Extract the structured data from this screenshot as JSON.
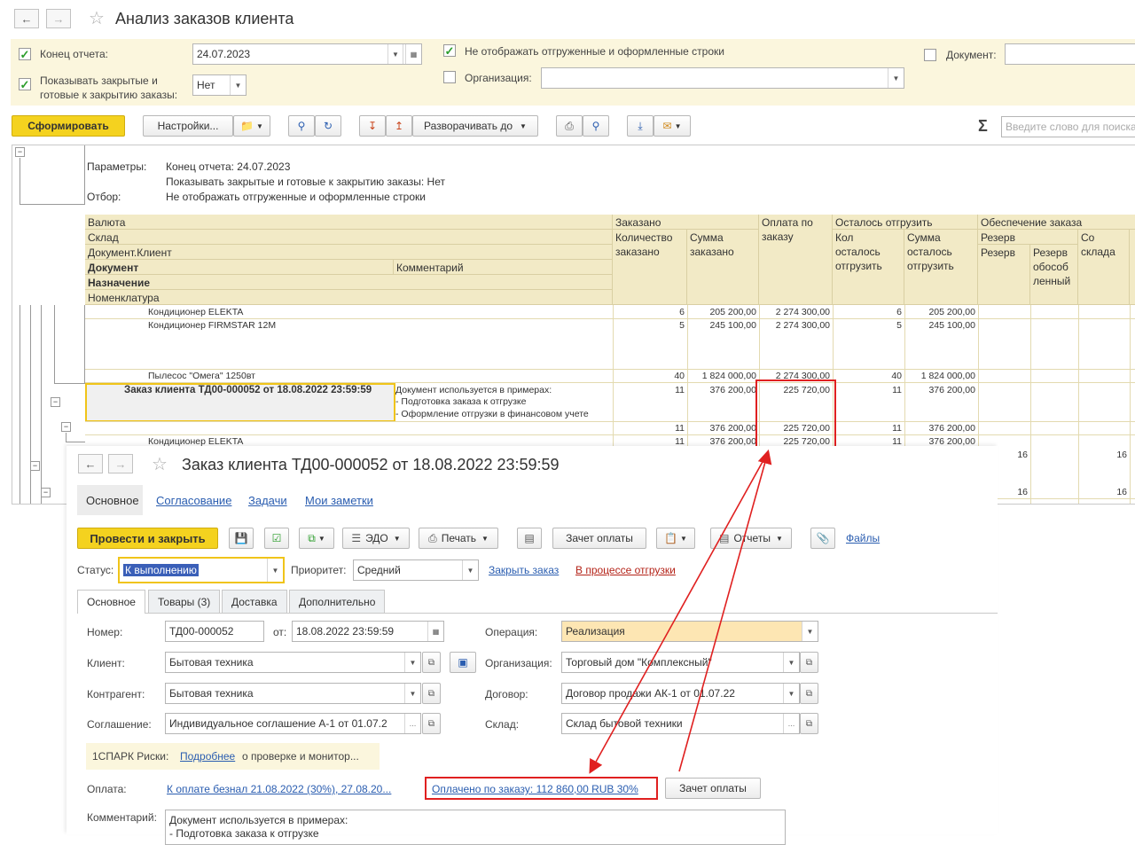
{
  "report": {
    "title": "Анализ заказов клиента",
    "end_label": "Конец отчета:",
    "end_date": "24.07.2023",
    "closed_label_1": "Показывать закрытые и",
    "closed_label_2": "готовые к закрытию заказы:",
    "closed_value": "Нет",
    "hide_label": "Не отображать отгруженные и оформленные строки",
    "org_label": "Организация:",
    "doc_label": "Документ:",
    "generate_btn": "Сформировать",
    "settings_btn": "Настройки...",
    "expand_btn": "Разворачивать до",
    "search_placeholder": "Введите слово для поиска",
    "sum_icon": "Σ",
    "params": {
      "params_label": "Параметры:",
      "p1": "Конец отчета: 24.07.2023",
      "p2": "Показывать закрытые и готовые к закрытию заказы: Нет",
      "filter_label": "Отбор:",
      "f1": "Не отображать отгруженные и оформленные строки"
    },
    "headers": {
      "currency": "Валюта",
      "warehouse": "Склад",
      "doc_client": "Документ.Клиент",
      "document": "Документ",
      "comment": "Комментарий",
      "purpose": "Назначение",
      "nomenclature": "Номенклатура",
      "ordered": "Заказано",
      "qty_ordered": "Количество заказано",
      "sum_ordered": "Сумма заказано",
      "payment": "Оплата по заказу",
      "left_to_ship": "Осталось отгрузить",
      "qty_left": "Кол осталось отгрузить",
      "sum_left": "Сумма осталось отгрузить",
      "provision": "Обеспечение заказа",
      "reserve": "Резерв",
      "reserve2": "Резерв",
      "reserve_sep": "Резерв обособ ленный",
      "from_stock": "Со склада"
    },
    "rows": [
      {
        "name": "Кондиционер ELEKTA",
        "qty": "6",
        "sum": "205 200,00",
        "pay": "2 274 300,00",
        "qleft": "6",
        "sleft": "205 200,00"
      },
      {
        "name": "Кондиционер FIRMSTAR 12M",
        "qty": "5",
        "sum": "245 100,00",
        "pay": "2 274 300,00",
        "qleft": "5",
        "sleft": "245 100,00"
      },
      {
        "name": "Пылесос \"Омега\" 1250вт",
        "qty": "40",
        "sum": "1 824 000,00",
        "pay": "2 274 300,00",
        "qleft": "40",
        "sleft": "1 824 000,00"
      }
    ],
    "order_row": {
      "doc": "Заказ клиента ТД00-000052 от 18.08.2022 23:59:59",
      "comment1": "Документ используется в примерах:",
      "comment2": "- Подготовка заказа к отгрузке",
      "comment3": "- Оформление отгрузки в финансовом учете",
      "qty": "11",
      "sum": "376 200,00",
      "pay": "225 720,00",
      "qleft": "11",
      "sleft": "376 200,00"
    },
    "sub_row": {
      "qty": "11",
      "sum": "376 200,00",
      "pay": "225 720,00",
      "qleft": "11",
      "sleft": "376 200,00"
    },
    "elekta_row": {
      "name": "Кондиционер ELEKTA",
      "qty": "11",
      "sum": "376 200,00",
      "pay": "225 720,00",
      "qleft": "11",
      "sleft": "376 200,00"
    },
    "right_vals": [
      "16",
      "16",
      "16",
      "16"
    ]
  },
  "order": {
    "title": "Заказ клиента ТД00-000052 от 18.08.2022 23:59:59",
    "nav": [
      "Основное",
      "Согласование",
      "Задачи",
      "Мои заметки"
    ],
    "post_close": "Провести и закрыть",
    "edo": "ЭДО",
    "print": "Печать",
    "offset_btn": "Зачет оплаты",
    "reports": "Отчеты",
    "files": "Файлы",
    "status_label": "Статус:",
    "status_value": "К выполнению",
    "priority_label": "Приоритет:",
    "priority_value": "Средний",
    "close_order": "Закрыть заказ",
    "in_shipment": "В процессе отгрузки",
    "tabs": [
      "Основное",
      "Товары (3)",
      "Доставка",
      "Дополнительно"
    ],
    "number_label": "Номер:",
    "number_value": "ТД00-000052",
    "from_label": "от:",
    "date_value": "18.08.2022 23:59:59",
    "operation_label": "Операция:",
    "operation_value": "Реализация",
    "client_label": "Клиент:",
    "client_value": "Бытовая техника",
    "org_label": "Организация:",
    "org_value": "Торговый дом \"Комплексный\"",
    "counterparty_label": "Контрагент:",
    "counterparty_value": "Бытовая техника",
    "contract_label": "Договор:",
    "contract_value": "Договор продажи АК-1 от 01.07.22",
    "agreement_label": "Соглашение:",
    "agreement_value": "Индивидуальное соглашение А-1 от 01.07.2",
    "warehouse_label": "Склад:",
    "warehouse_value": "Склад бытовой техники",
    "spark_label": "1СПАРК Риски:",
    "spark_link": "Подробнее",
    "spark_text": "о проверке и монитор...",
    "payment_label": "Оплата:",
    "payment_link": "К оплате безнал 21.08.2022 (30%), 27.08.20...",
    "paid_link": "Оплачено по заказу: 112 860,00 RUB 30%",
    "offset_btn2": "Зачет оплаты",
    "comment_label": "Комментарий:",
    "comment1": "Документ используется в примерах:",
    "comment2": "- Подготовка заказа к отгрузке"
  },
  "colors": {
    "accent": "#f4d21f",
    "highlight": "#e02020"
  }
}
